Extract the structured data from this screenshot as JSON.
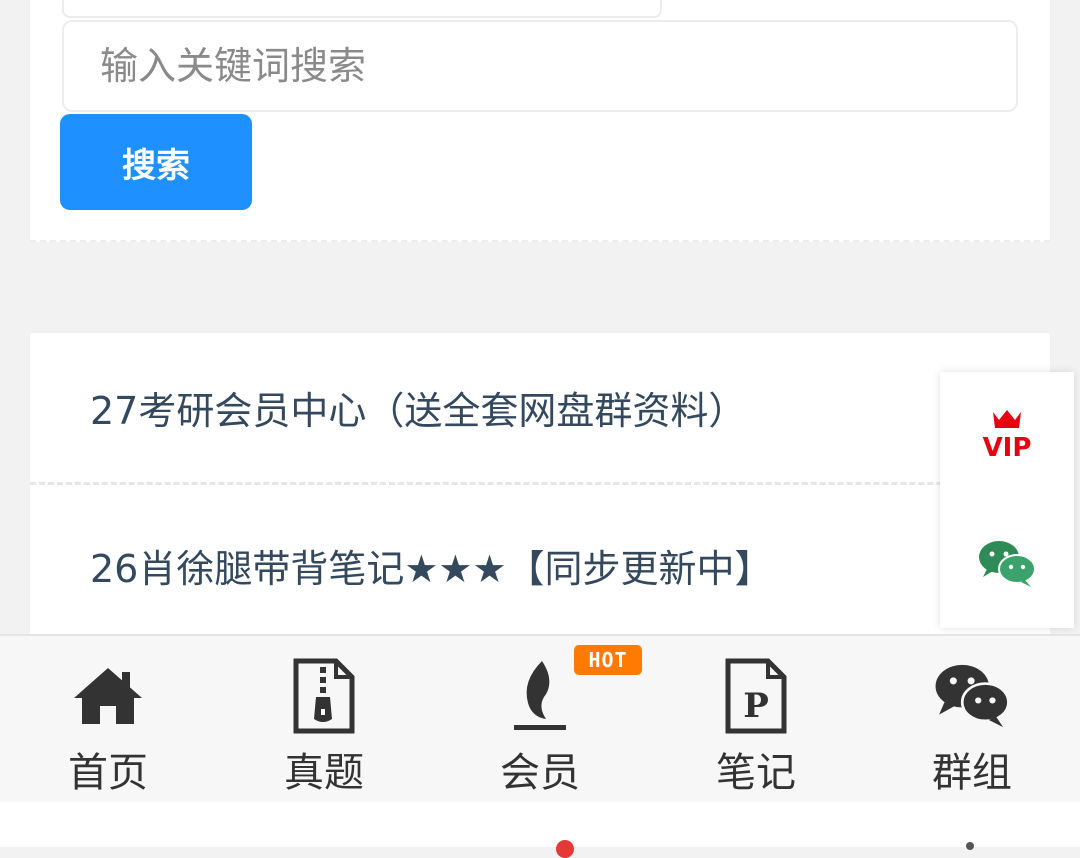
{
  "search": {
    "placeholder": "输入关键词搜索",
    "button_label": "搜索"
  },
  "list": {
    "items": [
      {
        "label": "27考研会员中心（送全套网盘群资料）"
      },
      {
        "label": "26肖徐腿带背笔记★★★【同步更新中】"
      }
    ]
  },
  "float_panel": {
    "vip_label": "VIP",
    "vip_icon": "crown-icon",
    "wechat_icon": "wechat-icon"
  },
  "tabbar": {
    "tabs": [
      {
        "label": "首页",
        "icon": "home-icon"
      },
      {
        "label": "真题",
        "icon": "zip-file-icon"
      },
      {
        "label": "会员",
        "icon": "flame-icon"
      },
      {
        "label": "笔记",
        "icon": "pdf-file-icon"
      },
      {
        "label": "群组",
        "icon": "wechat-icon"
      }
    ],
    "hot_badge": "HOT"
  },
  "colors": {
    "accent": "#1e90ff",
    "text": "#34495e",
    "vip_red": "#e60012",
    "wechat_green": "#2e8b57",
    "hot_orange": "#ff7a00"
  }
}
